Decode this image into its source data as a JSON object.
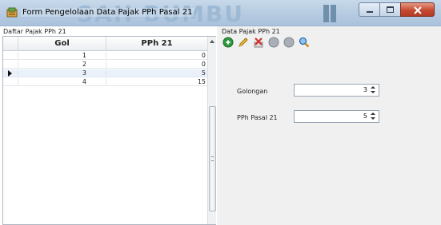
{
  "window": {
    "title": "Form Pengelolaan Data Pajak PPh Pasal 21",
    "watermark": "SAH BUMBU",
    "icon": "app-form-icon"
  },
  "left_panel": {
    "label": "Daftar Pajak PPh 21",
    "columns": [
      "Gol",
      "PPh 21"
    ],
    "rows": [
      {
        "gol": "1",
        "pph": "0"
      },
      {
        "gol": "2",
        "pph": "0"
      },
      {
        "gol": "3",
        "pph": "5"
      },
      {
        "gol": "4",
        "pph": "15"
      }
    ],
    "selected_row": 2
  },
  "right_panel": {
    "label": "Data Pajak PPh 21",
    "toolbar": [
      "add-icon",
      "edit-icon",
      "delete-icon",
      "save-icon",
      "cancel-icon",
      "search-icon"
    ],
    "golongan_label": "Golongan",
    "golongan_value": "3",
    "pph_label": "PPh Pasal 21",
    "pph_value": "5"
  },
  "colors": {
    "titlebar": "#b9cde2",
    "close_button": "#c74a32",
    "selected_row": "#eaf1fb",
    "panel_bg": "#f0f0f0"
  }
}
